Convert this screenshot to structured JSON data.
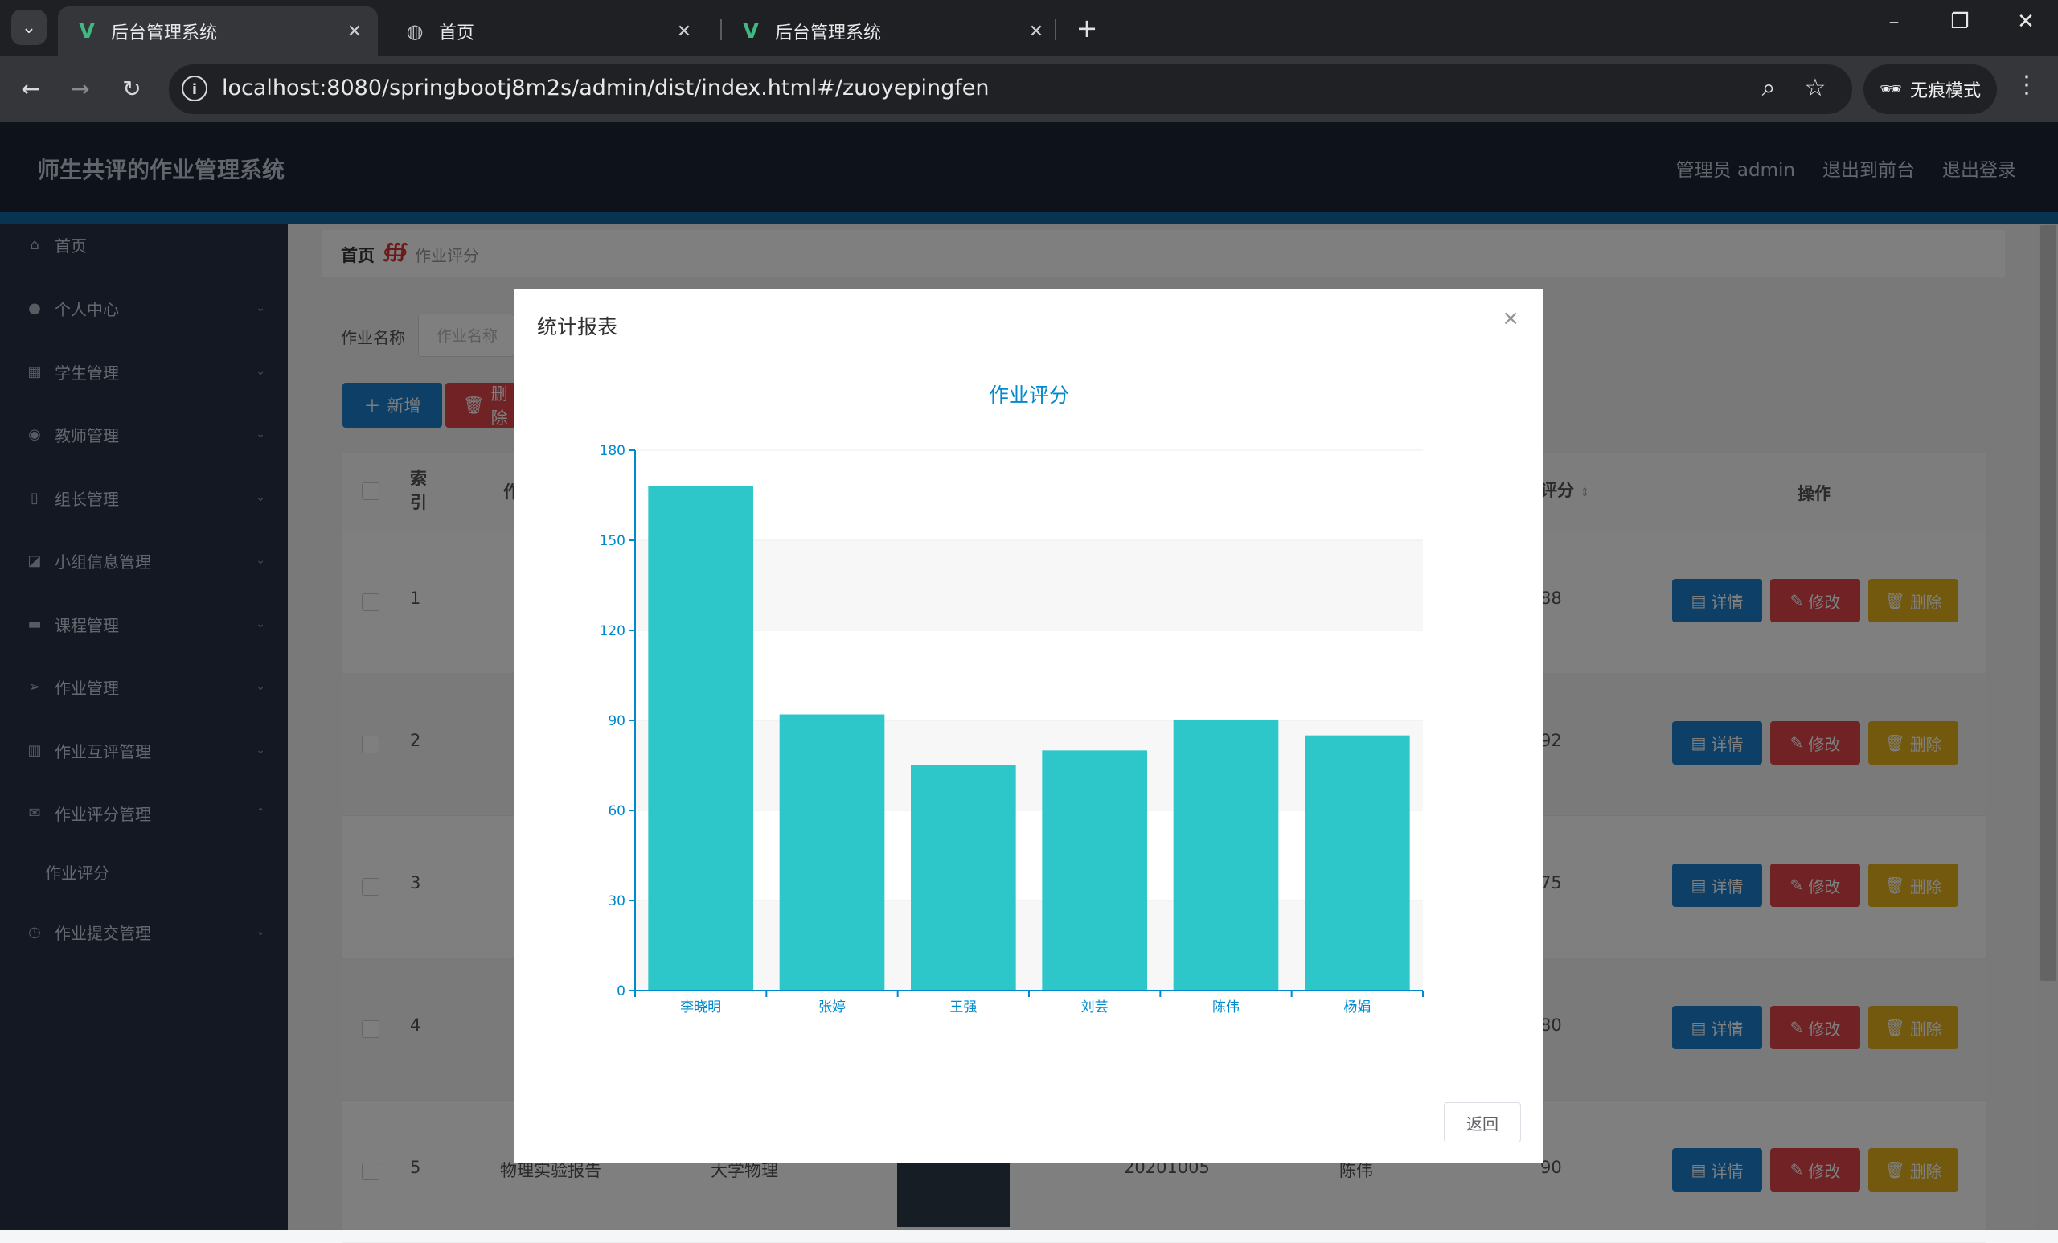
{
  "browser": {
    "tabs": [
      {
        "title": "后台管理系统",
        "icon": "vue-icon",
        "active": true
      },
      {
        "title": "首页",
        "icon": "globe-icon",
        "active": false
      },
      {
        "title": "后台管理系统",
        "icon": "vue-icon",
        "active": false
      }
    ],
    "url": "localhost:8080/springbootj8m2s/admin/dist/index.html#/zuoyepingfen",
    "incognito_label": "无痕模式"
  },
  "header": {
    "title": "师生共评的作业管理系统",
    "user": "管理员 admin",
    "to_front": "退出到前台",
    "logout": "退出登录"
  },
  "sidebar": {
    "items": [
      {
        "label": "首页",
        "icon": "home-icon"
      },
      {
        "label": "个人中心",
        "icon": "user-icon"
      },
      {
        "label": "学生管理",
        "icon": "grid-icon"
      },
      {
        "label": "教师管理",
        "icon": "pin-icon"
      },
      {
        "label": "组长管理",
        "icon": "mic-icon"
      },
      {
        "label": "小组信息管理",
        "icon": "chart-icon"
      },
      {
        "label": "课程管理",
        "icon": "chat-icon"
      },
      {
        "label": "作业管理",
        "icon": "send-icon"
      },
      {
        "label": "作业互评管理",
        "icon": "bars-icon"
      },
      {
        "label": "作业评分管理",
        "icon": "mail-icon"
      },
      {
        "label": "作业提交管理",
        "icon": "clock-icon"
      }
    ],
    "sub_item": "作业评分"
  },
  "breadcrumb": {
    "home": "首页",
    "separator": "∰",
    "current": "作业评分"
  },
  "search": {
    "label": "作业名称",
    "placeholder": "作业名称"
  },
  "actions": {
    "add": "新增",
    "delete": "删除"
  },
  "table": {
    "headers": {
      "index": "索引",
      "name": "作",
      "score": "评分",
      "ops": "操作"
    },
    "rows": [
      {
        "index": "1",
        "score": "88"
      },
      {
        "index": "2",
        "score": "92"
      },
      {
        "index": "3",
        "score": "75"
      },
      {
        "index": "4",
        "score": "80"
      },
      {
        "index": "5",
        "score": "90",
        "name": "物理实验报告",
        "course": "大学物理",
        "date": "20201005",
        "teacher": "陈伟"
      }
    ],
    "row_actions": {
      "detail": "详情",
      "edit": "修改",
      "delete": "删除"
    }
  },
  "modal": {
    "title": "统计报表",
    "back_label": "返回"
  },
  "chart_data": {
    "type": "bar",
    "title": "作业评分",
    "categories": [
      "李晓明",
      "张婷",
      "王强",
      "刘芸",
      "陈伟",
      "杨娟"
    ],
    "values": [
      168,
      92,
      75,
      80,
      90,
      85
    ],
    "yticks": [
      "0",
      "30",
      "60",
      "90",
      "120",
      "150",
      "180"
    ],
    "ylim": [
      0,
      180
    ],
    "color": "#2ec7c9",
    "axis_color": "#008acd"
  }
}
